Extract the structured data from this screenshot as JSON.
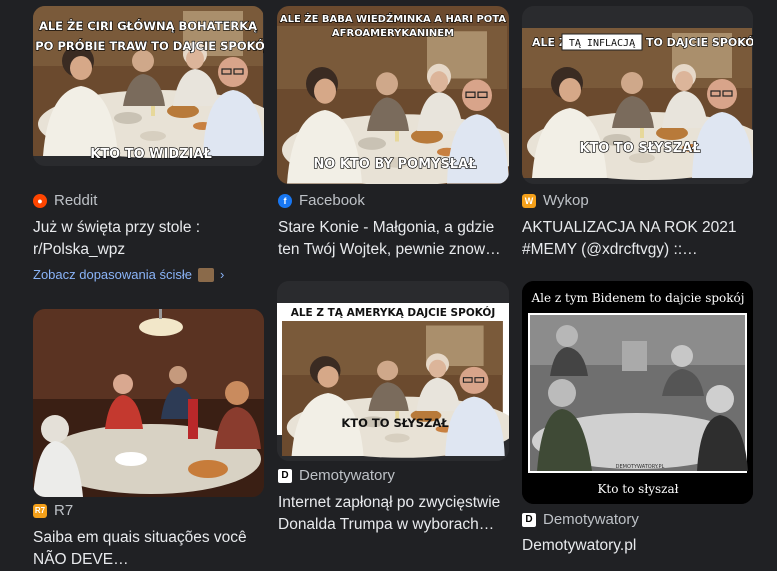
{
  "results": [
    {
      "source": "Reddit",
      "title": "Już w święta przy stole : r/Polska_wpz",
      "caption_top_1": "ALE ŻE CIRI GŁÓWNĄ BOHATERKĄ",
      "caption_top_2": "I PO PRÓBIE TRAW TO DAJCIE SPOKÓJ",
      "caption_bottom": "KTO TO WIDZIAŁ",
      "more_link": "Zobacz dopasowania ścisłe"
    },
    {
      "source": "Facebook",
      "title": "Stare Konie - Małgonia, a gdzie ten Twój Wojtek, pewnie znow…",
      "caption_top_1": "ALE ŻE BABA WIEDŹMINKA A HARI POTA",
      "caption_top_2": "AFROAMERYKANINEM",
      "caption_bottom": "NO KTO BY POMYSŁAŁ"
    },
    {
      "source": "Wykop",
      "title": "AKTUALIZACJA NA ROK 2021 #MEMY (@xdrcftvgy) ::…",
      "caption_top_a": "ALE Z",
      "caption_top_box": "TĄ INFLACJĄ",
      "caption_top_b": "TO DAJCIE SPOKÓJ",
      "caption_bottom": "KTO TO SŁYSZAŁ"
    },
    {
      "source": "R7",
      "title": "Saiba em quais situações você NÃO DEVE…"
    },
    {
      "source": "Demotywatory",
      "title": "Internet zapłonął po zwycięstwie Donalda Trumpa w wyborach…",
      "caption_top": "ALE Z TĄ AMERYKĄ DAJCIE SPOKÓJ",
      "caption_bottom": "KTO TO SŁYSZAŁ"
    },
    {
      "source": "Demotywatory",
      "title": "Demotywatory.pl",
      "caption_top": "Ale z tym Bidenem to dajcie spokój",
      "caption_bottom": "Kto to słyszał",
      "watermark": "DEMOTYWATORY.PL"
    }
  ],
  "colors": {
    "background": "#202124",
    "text": "#e8eaed",
    "source_text": "#bdc1c6",
    "link": "#8ab4f8",
    "reddit": "#ff4500",
    "facebook": "#1877f2",
    "wykop": "#f4a01a"
  }
}
